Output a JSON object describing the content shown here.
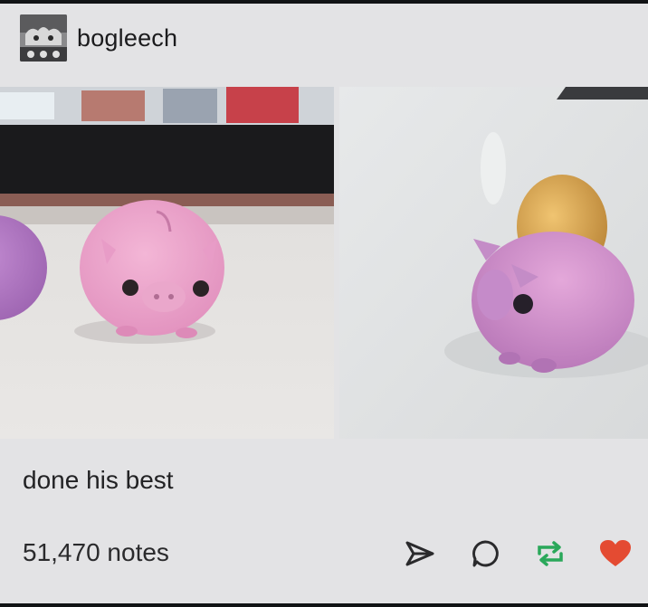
{
  "post": {
    "username": "bogleech",
    "caption": "done his best",
    "notes": "51,470 notes",
    "images": [
      {
        "name": "photo-pig-pair",
        "description_icon": "piggy-bank-photo"
      },
      {
        "name": "photo-pig-coin",
        "description_icon": "piggy-bank-coin-photo"
      }
    ]
  },
  "actions": {
    "share_icon": "send-icon",
    "reply_icon": "reply-bubble-icon",
    "reblog_icon": "reblog-icon",
    "like_icon": "heart-icon"
  },
  "colors": {
    "background": "#e3e3e5",
    "reblog_green": "#2aa85a",
    "like_red": "#e44b32",
    "text": "#1b1b1d"
  }
}
